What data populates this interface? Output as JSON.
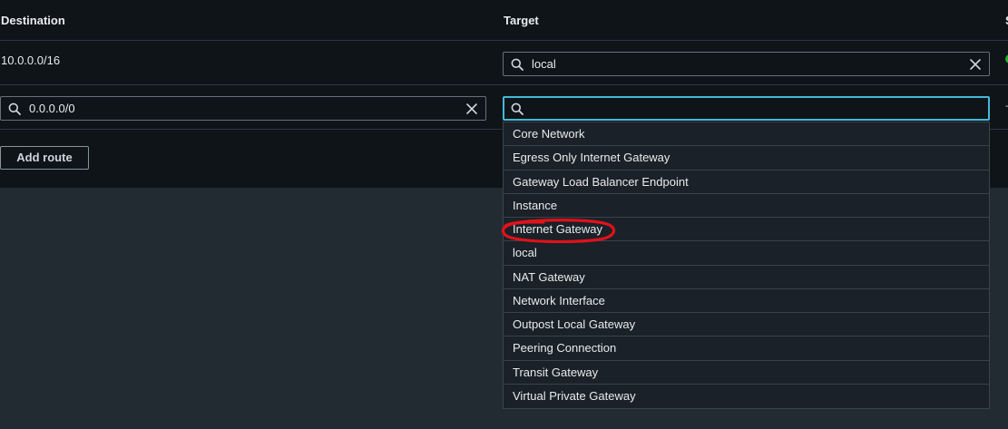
{
  "table": {
    "headers": {
      "destination": "Destination",
      "target": "Target",
      "status_partial": "S"
    }
  },
  "routes": [
    {
      "destination": "10.0.0.0/16",
      "target": "local",
      "status": "active"
    },
    {
      "destination": "0.0.0.0/0",
      "target": "",
      "status": "-"
    }
  ],
  "actions": {
    "add_route_label": "Add route"
  },
  "target_dropdown": {
    "options": [
      "Core Network",
      "Egress Only Internet Gateway",
      "Gateway Load Balancer Endpoint",
      "Instance",
      "Internet Gateway",
      "local",
      "NAT Gateway",
      "Network Interface",
      "Outpost Local Gateway",
      "Peering Connection",
      "Transit Gateway",
      "Virtual Private Gateway"
    ],
    "highlighted_option": "Internet Gateway"
  },
  "colors": {
    "focus_border": "#44b9d6",
    "annotation": "#e0121a",
    "status_success": "#29ad32"
  },
  "icons": {
    "search": "search-icon",
    "clear": "close-icon"
  }
}
